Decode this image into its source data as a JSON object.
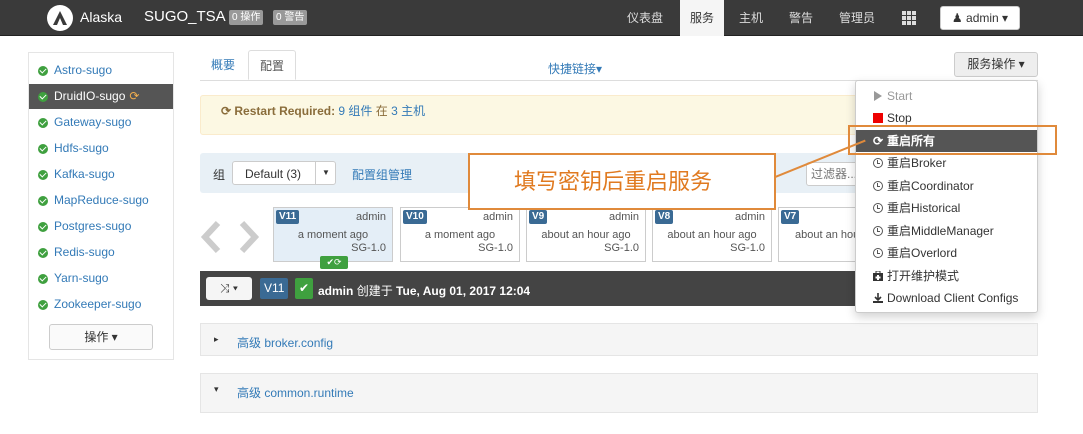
{
  "navbar": {
    "app_name": "Alaska",
    "cluster_name": "SUGO_TSA",
    "ops_badge": "0 操作",
    "alerts_badge": "0 警告",
    "items": [
      "仪表盘",
      "服务",
      "主机",
      "警告",
      "管理员"
    ],
    "active_item": "服务",
    "user_label": "admin ▾"
  },
  "sidebar": {
    "items": [
      {
        "label": "Astro-sugo"
      },
      {
        "label": "DruidIO-sugo"
      },
      {
        "label": "Gateway-sugo"
      },
      {
        "label": "Hdfs-sugo"
      },
      {
        "label": "Kafka-sugo"
      },
      {
        "label": "MapReduce-sugo"
      },
      {
        "label": "Postgres-sugo"
      },
      {
        "label": "Redis-sugo"
      },
      {
        "label": "Yarn-sugo"
      },
      {
        "label": "Zookeeper-sugo"
      }
    ],
    "active_index": 1,
    "ops_button": "操作 ▾"
  },
  "tabs": {
    "summary": "概要",
    "configs": "配置",
    "quick_links": "快捷链接▾",
    "service_actions": "服务操作 ▾"
  },
  "alert": {
    "prefix": "⟳ Restart Required:",
    "count1": "9 组件",
    "mid": "在",
    "count2": "3 主机"
  },
  "config_group": {
    "label": "组",
    "selected": "Default (3)",
    "manage": "配置组管理",
    "filter_placeholder": "过滤器..."
  },
  "versions": [
    {
      "badge": "V11",
      "user": "admin",
      "time": "a moment ago",
      "stack": "SG-1.0",
      "current": true
    },
    {
      "badge": "V10",
      "user": "admin",
      "time": "a moment ago",
      "stack": "SG-1.0",
      "current": false
    },
    {
      "badge": "V9",
      "user": "admin",
      "time": "about an hour ago",
      "stack": "SG-1.0",
      "current": false
    },
    {
      "badge": "V8",
      "user": "admin",
      "time": "about an hour ago",
      "stack": "SG-1.0",
      "current": false
    },
    {
      "badge": "V7",
      "user": "",
      "time": "about an hou",
      "stack": "",
      "current": false
    }
  ],
  "current_version": {
    "shuffle": "⤨ ▾",
    "badge": "V11",
    "check": "✔",
    "user": "admin",
    "created_text": "创建于",
    "date": "Tue, Aug 01, 2017 12:04"
  },
  "sections": [
    {
      "caret": "▸",
      "title": "高级 broker.config"
    },
    {
      "caret": "▾",
      "title": "高级 common.runtime"
    }
  ],
  "dropdown": {
    "items": [
      {
        "label": "Start",
        "icon": "play-icon",
        "state": "disabled"
      },
      {
        "label": "Stop",
        "icon": "stop-icon",
        "state": "normal"
      },
      {
        "label": "重启所有",
        "icon": "restart-icon",
        "state": "highlight"
      },
      {
        "label": "重启Broker",
        "icon": "clock-icon",
        "state": "normal"
      },
      {
        "label": "重启Coordinator",
        "icon": "clock-icon",
        "state": "normal"
      },
      {
        "label": "重启Historical",
        "icon": "clock-icon",
        "state": "normal"
      },
      {
        "label": "重启MiddleManager",
        "icon": "clock-icon",
        "state": "normal"
      },
      {
        "label": "重启Overlord",
        "icon": "clock-icon",
        "state": "normal"
      },
      {
        "label": "打开维护模式",
        "icon": "medkit-icon",
        "state": "normal"
      },
      {
        "label": "Download Client Configs",
        "icon": "download-icon",
        "state": "normal"
      }
    ]
  },
  "annotation": {
    "text": "填写密钥后重启服务"
  },
  "colors": {
    "navbar": "#3a3a3a",
    "link": "#337ab7",
    "success": "#3fa03f",
    "callout": "#e08a3b",
    "version_badge": "#3a6a94"
  }
}
